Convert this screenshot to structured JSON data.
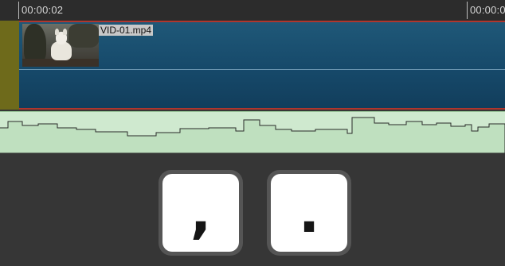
{
  "timeline": {
    "ruler": {
      "timecode_start": "00:00:02",
      "timecode_end": "00:00:0"
    },
    "video_track": {
      "clip_name": "VID-01.mp4",
      "colors": {
        "clip": "#1a5070",
        "selection_border": "#b0362d",
        "track_side": "#6e6a1b"
      }
    },
    "audio_track": {
      "colors": {
        "waveform_fill": "#cfe9cf",
        "waveform_line": "#2a2a2a"
      }
    }
  },
  "keys": {
    "comma": ",",
    "period": "."
  }
}
